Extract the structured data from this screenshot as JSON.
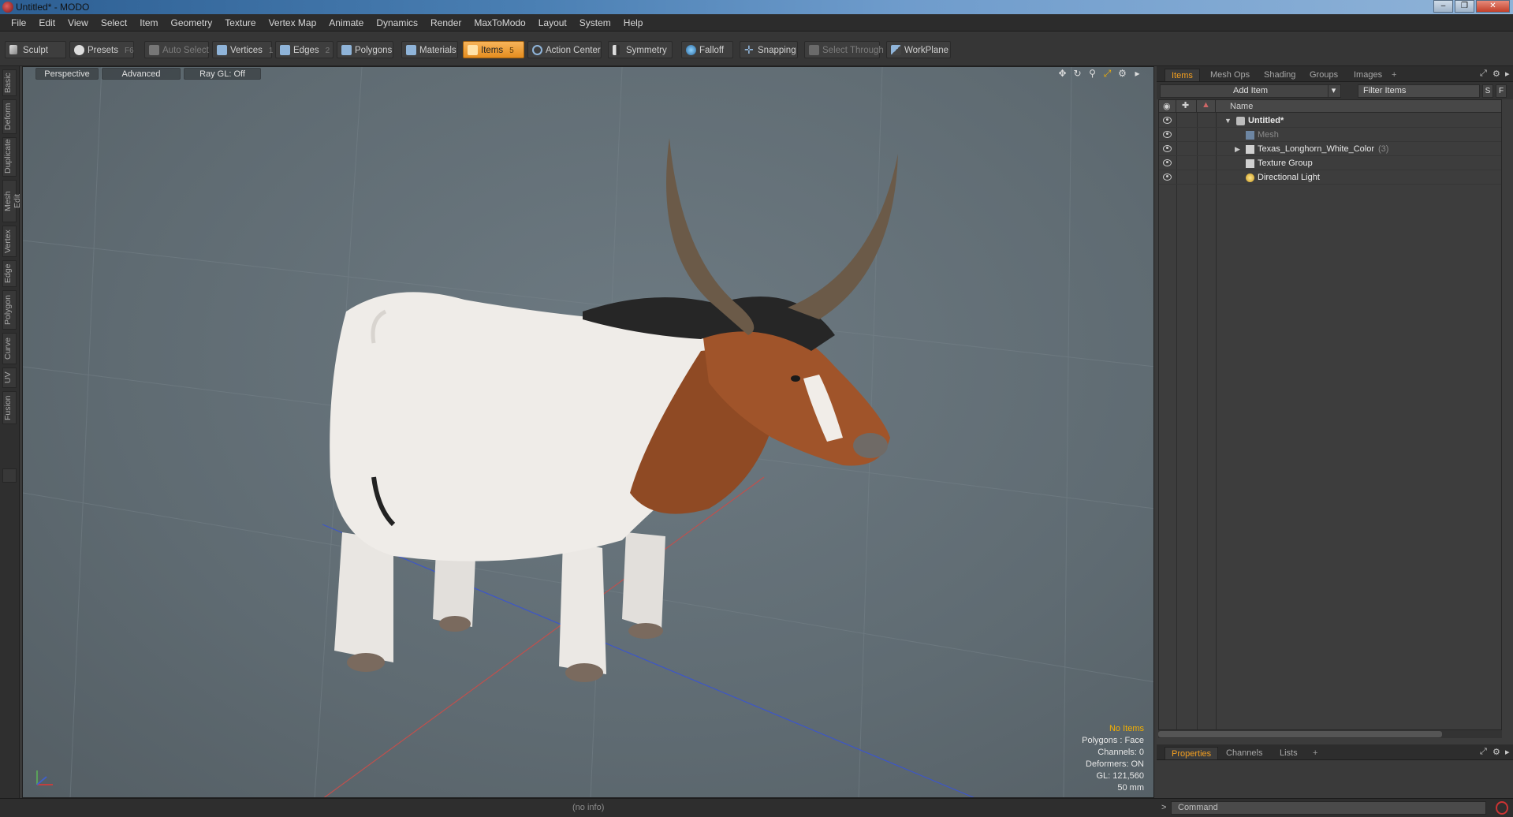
{
  "window": {
    "title": "Untitled* - MODO",
    "buttons": [
      "–",
      "❐",
      "✕"
    ]
  },
  "menu": [
    "File",
    "Edit",
    "View",
    "Select",
    "Item",
    "Geometry",
    "Texture",
    "Vertex Map",
    "Animate",
    "Dynamics",
    "Render",
    "MaxToModo",
    "Layout",
    "System",
    "Help"
  ],
  "toolbar": {
    "sculpt": "Sculpt",
    "presets": "Presets",
    "presets_hotkey": "F6",
    "auto_select": "Auto Select",
    "vertices": "Vertices",
    "vertices_hotkey": "1",
    "edges": "Edges",
    "edges_hotkey": "2",
    "polygons": "Polygons",
    "materials": "Materials",
    "items": "Items",
    "items_hotkey": "5",
    "action_center": "Action Center",
    "symmetry": "Symmetry",
    "falloff": "Falloff",
    "snapping": "Snapping",
    "select_through": "Select Through",
    "workplane": "WorkPlane"
  },
  "left_tabs": [
    "Basic",
    "Deform",
    "Duplicate",
    "Mesh Edit",
    "Vertex",
    "Edge",
    "Polygon",
    "Curve",
    "UV",
    "Fusion"
  ],
  "viewport": {
    "view_mode": "Perspective",
    "shading": "Advanced",
    "raygl": "Ray GL: Off",
    "stats": {
      "selection": "No Items",
      "polygons": "Polygons : Face",
      "channels": "Channels: 0",
      "deformers": "Deformers: ON",
      "gl": "GL: 121,560",
      "grid": "50 mm"
    }
  },
  "items_panel": {
    "tabs": [
      "Items",
      "Mesh Ops",
      "Shading",
      "Groups",
      "Images"
    ],
    "add_item": "Add Item",
    "filter_placeholder": "Filter Items",
    "btn_s": "S",
    "btn_f": "F",
    "column_name": "Name",
    "rows": [
      {
        "name": "Untitled*",
        "kind": "scene"
      },
      {
        "name": "Mesh",
        "kind": "mesh"
      },
      {
        "name": "Texas_Longhorn_White_Color",
        "count": "(3)",
        "kind": "group"
      },
      {
        "name": "Texture Group",
        "kind": "group"
      },
      {
        "name": "Directional Light",
        "kind": "light"
      }
    ]
  },
  "properties_panel": {
    "tabs": [
      "Properties",
      "Channels",
      "Lists"
    ]
  },
  "status": {
    "info": "(no info)"
  },
  "command": {
    "prompt": ">",
    "placeholder": "Command"
  },
  "colors": {
    "accent": "#f5a020",
    "highlight_text": "#f5b000",
    "viewport_bg": "#5f6b72"
  }
}
